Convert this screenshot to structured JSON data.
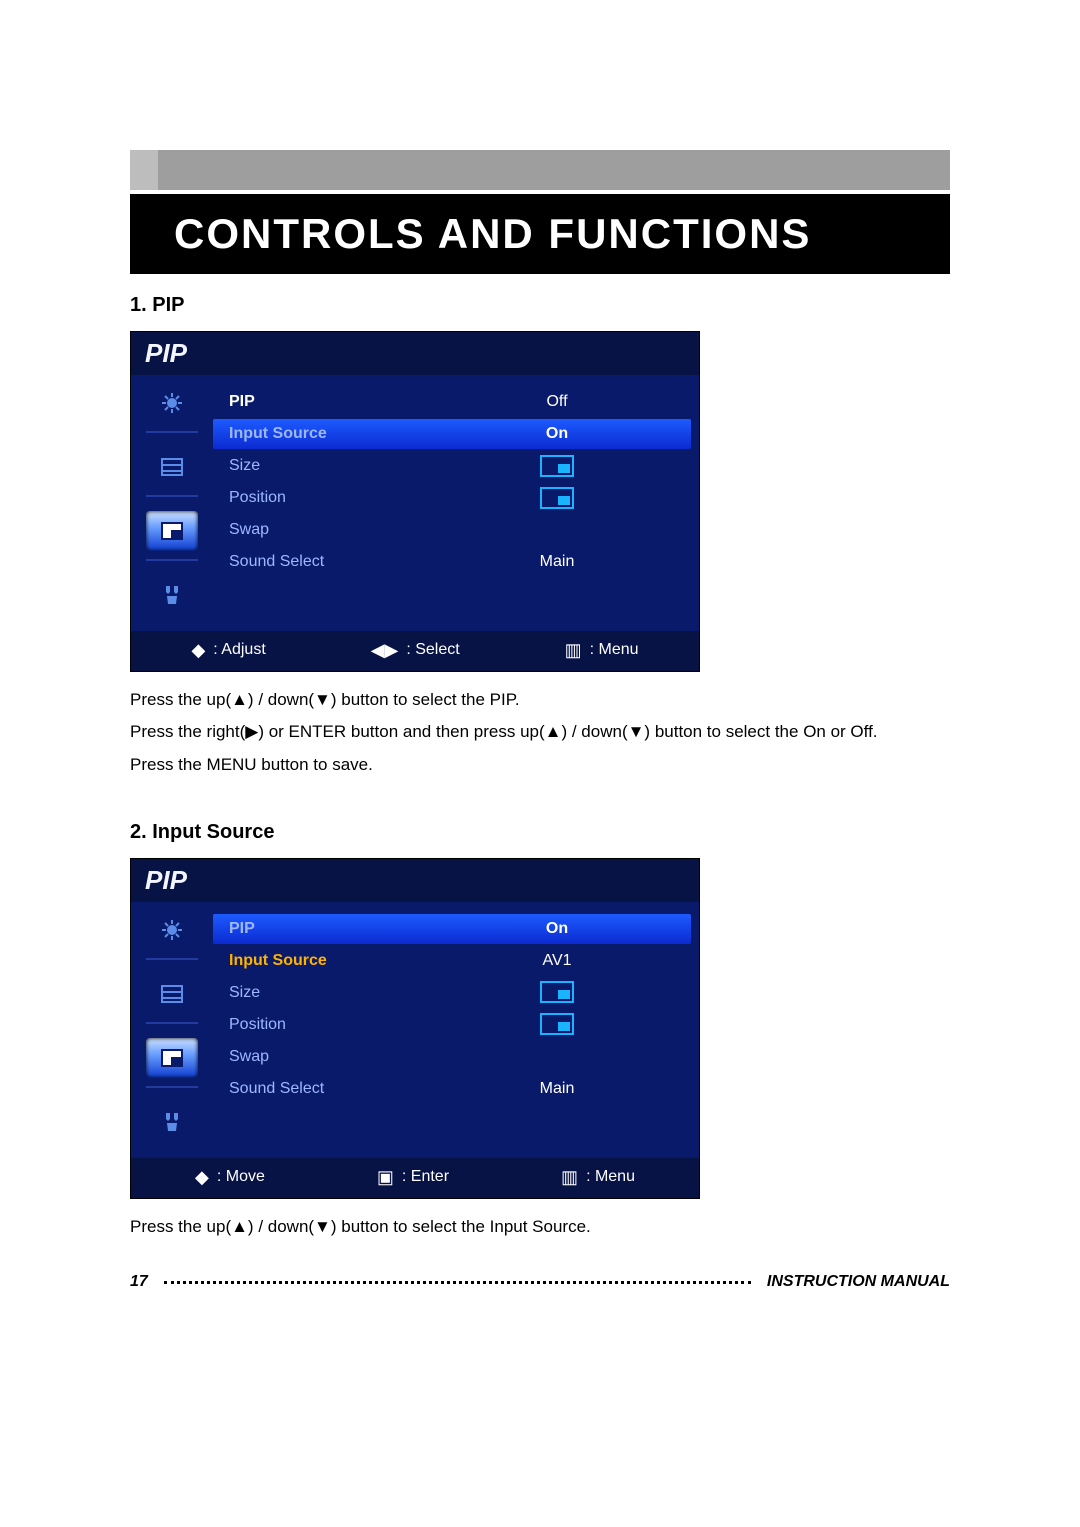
{
  "title": "CONTROLS AND FUNCTIONS",
  "sections": [
    {
      "heading": "1. PIP",
      "osd": {
        "title": "PIP",
        "sidebar": [
          "gear",
          "layout",
          "pip",
          "tools"
        ],
        "selectedSidebar": 2,
        "rows": [
          {
            "label": "PIP",
            "value": "Off",
            "style": "white"
          },
          {
            "label": "Input Source",
            "value": "On",
            "style": "highlight"
          },
          {
            "label": "Size",
            "value": "box1",
            "style": "normal"
          },
          {
            "label": "Position",
            "value": "box2",
            "style": "normal"
          },
          {
            "label": "Swap",
            "value": "",
            "style": "normal"
          },
          {
            "label": "Sound Select",
            "value": "Main",
            "style": "normal"
          }
        ],
        "footer": [
          {
            "glyph": "updown",
            "label": ": Adjust"
          },
          {
            "glyph": "leftright",
            "label": ": Select"
          },
          {
            "glyph": "menu",
            "label": ": Menu"
          }
        ]
      },
      "body": [
        "Press the up(▲) / down(▼) button to select the PIP.",
        "Press the right(▶) or ENTER button and then press up(▲) / down(▼) button to select the On or Off.",
        "Press the MENU button to save."
      ]
    },
    {
      "heading": "2. Input Source",
      "osd": {
        "title": "PIP",
        "sidebar": [
          "gear",
          "layout",
          "pip",
          "tools"
        ],
        "selectedSidebar": 2,
        "rows": [
          {
            "label": "PIP",
            "value": "On",
            "style": "highlight-pip"
          },
          {
            "label": "Input Source",
            "value": "AV1",
            "style": "highlight-label"
          },
          {
            "label": "Size",
            "value": "box1",
            "style": "normal"
          },
          {
            "label": "Position",
            "value": "box2",
            "style": "normal"
          },
          {
            "label": "Swap",
            "value": "",
            "style": "normal"
          },
          {
            "label": "Sound Select",
            "value": "Main",
            "style": "normal"
          }
        ],
        "footer": [
          {
            "glyph": "updown",
            "label": ": Move"
          },
          {
            "glyph": "enter",
            "label": ": Enter"
          },
          {
            "glyph": "menu",
            "label": ": Menu"
          }
        ]
      },
      "body": [
        "Press the up(▲) / down(▼) button to select the Input Source."
      ]
    }
  ],
  "footer": {
    "page": "17",
    "label": "INSTRUCTION MANUAL"
  }
}
